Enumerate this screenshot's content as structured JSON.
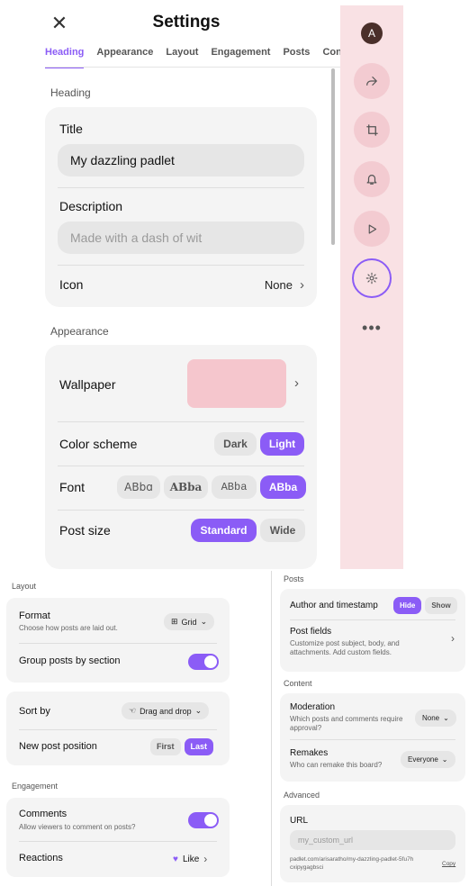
{
  "header": {
    "close_icon": "close-icon",
    "title": "Settings"
  },
  "tabs": [
    {
      "label": "Heading",
      "active": true
    },
    {
      "label": "Appearance"
    },
    {
      "label": "Layout"
    },
    {
      "label": "Engagement"
    },
    {
      "label": "Posts"
    },
    {
      "label": "Cont"
    }
  ],
  "heading": {
    "section_label": "Heading",
    "title_label": "Title",
    "title_value": "My dazzling padlet",
    "description_label": "Description",
    "description_placeholder": "Made with a dash of wit",
    "icon_label": "Icon",
    "icon_value": "None"
  },
  "appearance": {
    "section_label": "Appearance",
    "wallpaper_label": "Wallpaper",
    "wallpaper_color": "#f5c6cd",
    "color_scheme_label": "Color scheme",
    "color_scheme_options": [
      "Dark",
      "Light"
    ],
    "color_scheme_selected": "Light",
    "font_label": "Font",
    "font_options": [
      "ABbɑ",
      "ABba",
      "ABba",
      "ABba"
    ],
    "font_selected_index": 3,
    "post_size_label": "Post size",
    "post_size_options": [
      "Standard",
      "Wide"
    ],
    "post_size_selected": "Standard"
  },
  "rail": {
    "avatar_letter": "A",
    "buttons": [
      "share-icon",
      "remake-icon",
      "bell-icon",
      "play-icon",
      "gear-icon"
    ],
    "active_button": "gear-icon",
    "more": "•••"
  },
  "layout": {
    "section_label": "Layout",
    "format_label": "Format",
    "format_sub": "Choose how posts are laid out.",
    "format_value": "Grid",
    "group_label": "Group posts by section",
    "group_on": true,
    "sort_label": "Sort by",
    "sort_value": "Drag and drop",
    "new_post_label": "New post position",
    "new_post_options": [
      "First",
      "Last"
    ],
    "new_post_selected": "Last"
  },
  "engagement": {
    "section_label": "Engagement",
    "comments_label": "Comments",
    "comments_sub": "Allow viewers to comment on posts?",
    "comments_on": true,
    "reactions_label": "Reactions",
    "reactions_value": "Like"
  },
  "posts": {
    "section_label": "Posts",
    "author_label": "Author and timestamp",
    "author_options": [
      "Hide",
      "Show"
    ],
    "author_selected": "Hide",
    "fields_label": "Post fields",
    "fields_sub_1": "Customize post subject, body, and",
    "fields_sub_2": "attachments. Add custom fields."
  },
  "content": {
    "section_label": "Content",
    "moderation_label": "Moderation",
    "moderation_sub_1": "Which posts and comments require",
    "moderation_sub_2": "approval?",
    "moderation_value": "None",
    "remakes_label": "Remakes",
    "remakes_sub": "Who can remake this board?",
    "remakes_value": "Everyone"
  },
  "advanced": {
    "section_label": "Advanced",
    "url_label": "URL",
    "url_placeholder": "my_custom_url",
    "url_full_1": "padlet.com/arisaratho/my-dazzling-padlet-5fu7h",
    "url_full_2": "cxipygagbsci",
    "copy_label": "Copy"
  },
  "colors": {
    "accent": "#8b5cf6",
    "rail_bg": "#f9e1e4",
    "card_bg": "#f4f4f4"
  }
}
